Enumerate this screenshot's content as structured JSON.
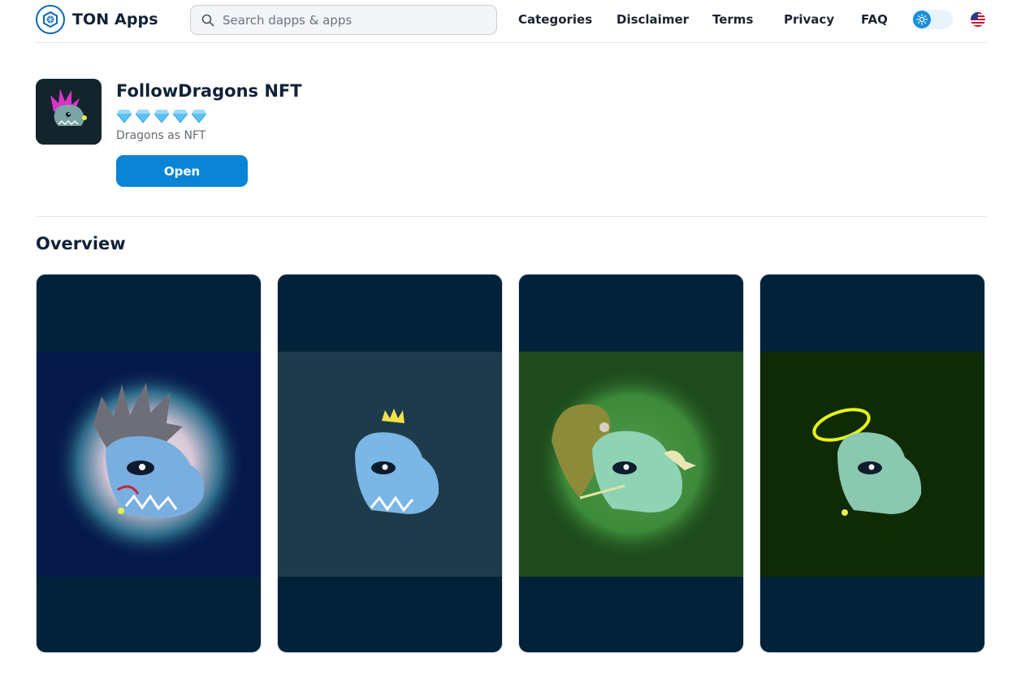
{
  "header": {
    "logo_text": "TON Apps",
    "search_placeholder": "Search dapps & apps",
    "nav": {
      "categories": "Categories",
      "disclaimer": "Disclaimer",
      "terms": "Terms",
      "privacy": "Privacy",
      "faq": "FAQ"
    }
  },
  "app": {
    "title": "FollowDragons NFT",
    "rating_icons": 5,
    "subtitle": "Dragons as NFT",
    "open_label": "Open"
  },
  "overview": {
    "title": "Overview",
    "screenshots": [
      {
        "background": "#061a4a",
        "glow": "#f6d6d6"
      },
      {
        "background": "#1d3b4a",
        "glow": "#1d3b4a"
      },
      {
        "background": "#1e4a1c",
        "glow": "#4a8f4a"
      },
      {
        "background": "#0f2a06",
        "glow": "#0f2a06"
      }
    ]
  },
  "colors": {
    "accent": "#0a84d6",
    "brand": "#0a66b8",
    "screenshot_frame": "#02223a"
  }
}
